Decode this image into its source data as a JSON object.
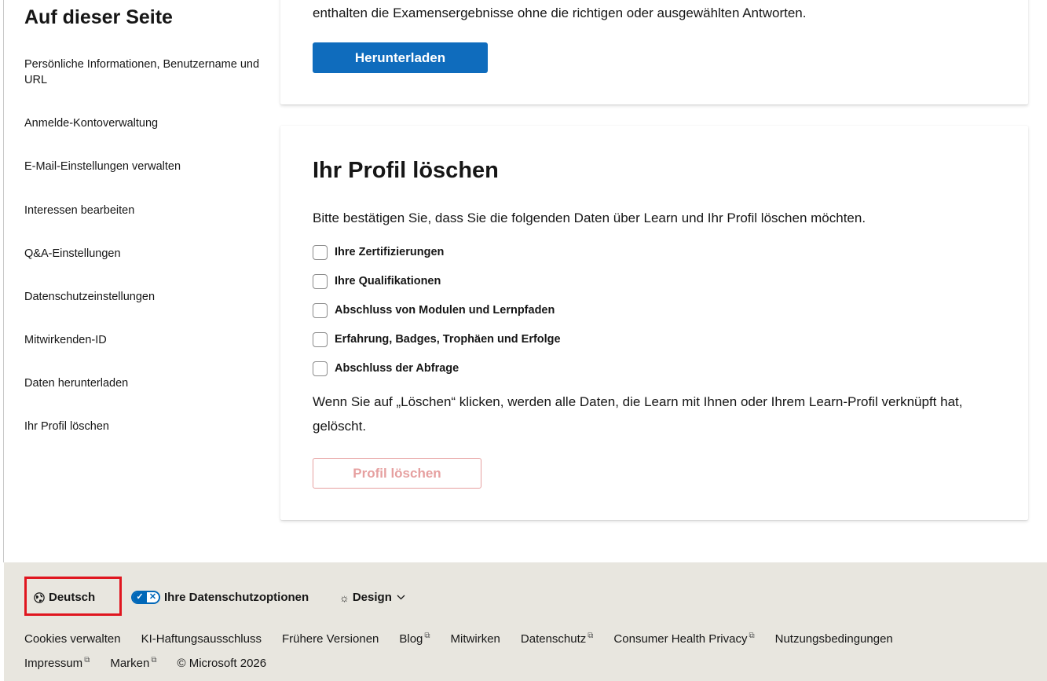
{
  "sidebar": {
    "title": "Auf dieser Seite",
    "items": [
      {
        "label": "Persönliche Informationen, Benutzername und URL"
      },
      {
        "label": "Anmelde-Kontoverwaltung"
      },
      {
        "label": "E-Mail-Einstellungen verwalten"
      },
      {
        "label": "Interessen bearbeiten"
      },
      {
        "label": "Q&A-Einstellungen"
      },
      {
        "label": "Datenschutzeinstellungen"
      },
      {
        "label": "Mitwirkenden-ID"
      },
      {
        "label": "Daten herunterladen"
      },
      {
        "label": "Ihr Profil löschen"
      }
    ]
  },
  "download_card": {
    "text": "enthalten die Examensergebnisse ohne die richtigen oder ausgewählten Antworten.",
    "button_label": "Herunterladen"
  },
  "delete_card": {
    "title": "Ihr Profil löschen",
    "confirm_text": "Bitte bestätigen Sie, dass Sie die folgenden Daten über Learn und Ihr Profil löschen möchten.",
    "checkboxes": [
      {
        "label": "Ihre Zertifizierungen",
        "checked": false
      },
      {
        "label": "Ihre Qualifikationen",
        "checked": false
      },
      {
        "label": "Abschluss von Modulen und Lernpfaden",
        "checked": false
      },
      {
        "label": "Erfahrung, Badges, Trophäen und Erfolge",
        "checked": false
      },
      {
        "label": "Abschluss der Abfrage",
        "checked": false
      }
    ],
    "warning_text": "Wenn Sie auf „Löschen“ klicken, werden alle Daten, die Learn mit Ihnen oder Ihrem Learn-Profil verknüpft hat, gelöscht.",
    "delete_button_label": "Profil löschen",
    "delete_button_enabled": false
  },
  "footer": {
    "language_label": "Deutsch",
    "privacy_options_label": "Ihre Datenschutzoptionen",
    "design_label": "Design",
    "links_row1": [
      {
        "label": "Cookies verwalten",
        "external": false
      },
      {
        "label": "KI-Haftungsausschluss",
        "external": false
      },
      {
        "label": "Frühere Versionen",
        "external": false
      },
      {
        "label": "Blog",
        "external": true
      },
      {
        "label": "Mitwirken",
        "external": false
      },
      {
        "label": "Datenschutz",
        "external": true
      },
      {
        "label": "Consumer Health Privacy",
        "external": true
      },
      {
        "label": "Nutzungsbedingungen",
        "external": false
      }
    ],
    "links_row2": [
      {
        "label": "Impressum",
        "external": true
      },
      {
        "label": "Marken",
        "external": true
      }
    ],
    "copyright": "© Microsoft 2026"
  },
  "colors": {
    "primary": "#0f6cbd",
    "footer_bg": "#e8e6df",
    "highlight": "#e0161f",
    "disabled_danger": "#e6a0a0"
  }
}
